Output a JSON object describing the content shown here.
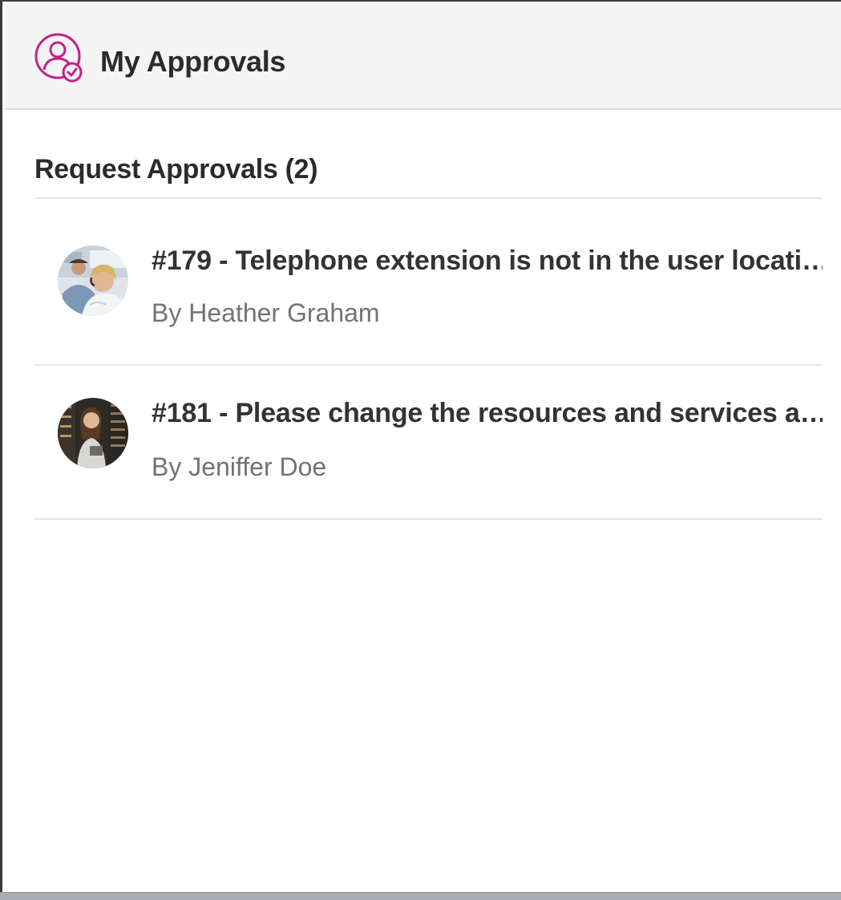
{
  "header": {
    "title": "My Approvals",
    "icon": "user-approval-icon",
    "accent_color": "#c2218b"
  },
  "section": {
    "title": "Request Approvals (2)"
  },
  "approvals": [
    {
      "title": "#179 - Telephone extension is not in the user locati…",
      "author": "By Heather Graham",
      "avatar": "call-center-photo"
    },
    {
      "title": "#181 - Please change the resources and services a…",
      "author": "By Jeniffer Doe",
      "avatar": "server-room-photo"
    }
  ]
}
